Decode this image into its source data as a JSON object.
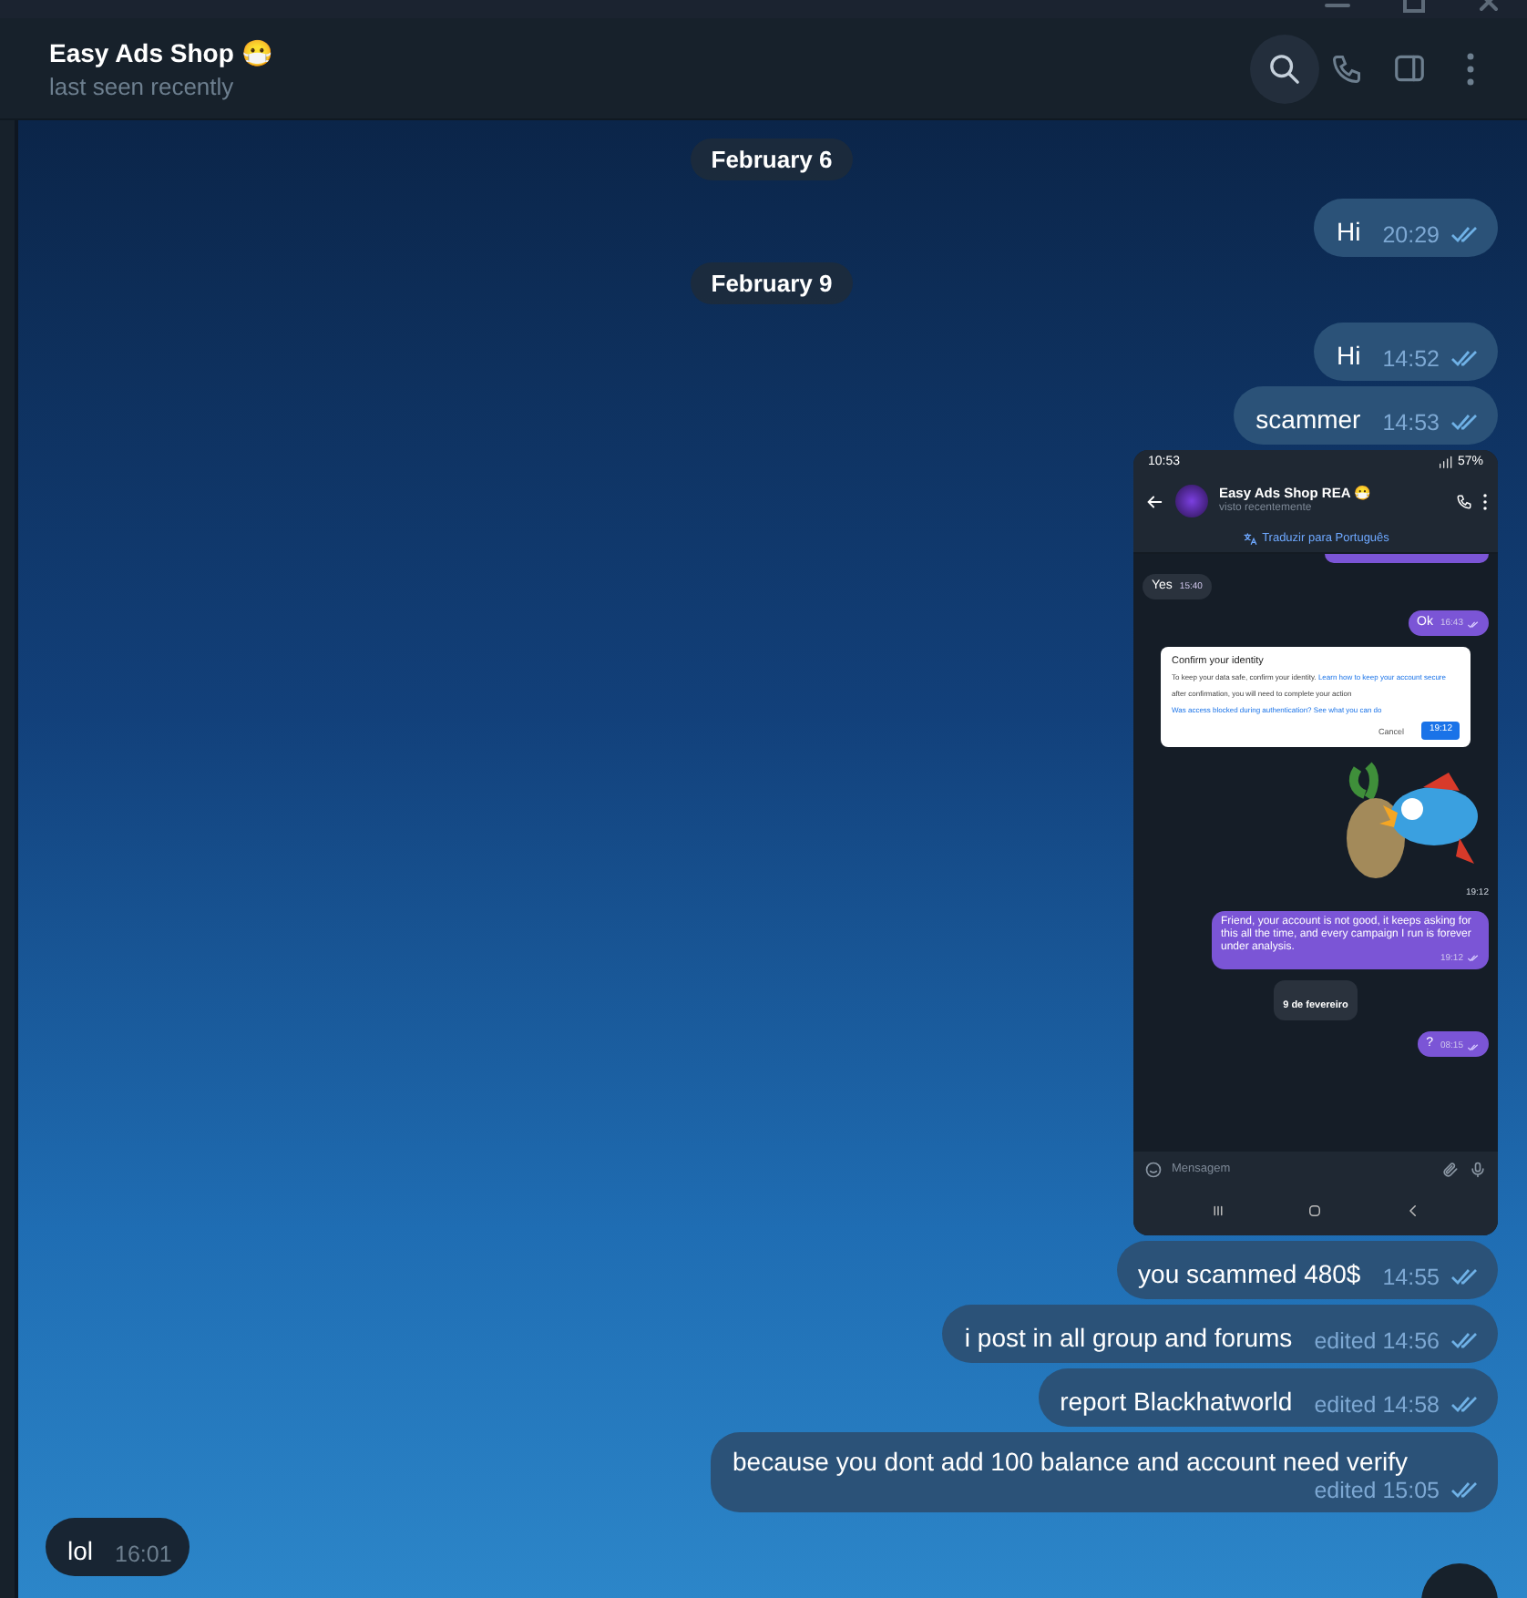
{
  "header": {
    "title": "Easy Ads Shop 😷",
    "status": "last seen recently"
  },
  "messages": [
    {
      "kind": "date",
      "text": "February 6"
    },
    {
      "kind": "text",
      "outgoing": true,
      "text": "Hi",
      "meta": "20:29",
      "read": true
    },
    {
      "kind": "date",
      "text": "February 9"
    },
    {
      "kind": "text",
      "outgoing": true,
      "text": "Hi",
      "meta": "14:52",
      "read": true
    },
    {
      "kind": "text",
      "outgoing": true,
      "text": "scammer",
      "meta": "14:53",
      "read": true
    },
    {
      "kind": "screenshot",
      "phone": {
        "clock": "10:53",
        "battery": "57%",
        "title": "Easy Ads Shop REA",
        "title_emoji": "😷",
        "subtitle": "visto recentemente",
        "translate": "Traduzir para Português",
        "placeholder": "Mensagem",
        "messages": [
          {
            "kind": "text",
            "outgoing": false,
            "text": "Yes",
            "time": "15:40"
          },
          {
            "kind": "text",
            "outgoing": true,
            "text": "Ok",
            "time": "16:43"
          },
          {
            "kind": "dialog",
            "title": "Confirm your identity",
            "body": "To keep your data safe, confirm your identity.",
            "link": "Learn how to keep your account secure",
            "note": "after confirmation, you will need to complete your action",
            "help": "Was access blocked during authentication? See what you can do",
            "cancel": "Cancel",
            "time": "19:12"
          },
          {
            "kind": "sticker",
            "time": "19:12"
          },
          {
            "kind": "text",
            "outgoing": true,
            "text": "Friend, your account is not good, it keeps asking for this all the time, and every campaign I run is forever under analysis.",
            "time": "19:12"
          },
          {
            "kind": "date",
            "text": "9 de fevereiro"
          },
          {
            "kind": "text",
            "outgoing": true,
            "text": "?",
            "time": "08:15"
          }
        ]
      }
    },
    {
      "kind": "text",
      "outgoing": true,
      "text": "you scammed 480$",
      "meta": "14:55",
      "read": true
    },
    {
      "kind": "text",
      "outgoing": true,
      "text": "i post in all group and forums",
      "meta": "edited 14:56",
      "read": true
    },
    {
      "kind": "text",
      "outgoing": true,
      "text": "report Blackhatworld",
      "meta": "edited 14:58",
      "read": true
    },
    {
      "kind": "text",
      "outgoing": true,
      "text": "because you dont add 100 balance and account need verify",
      "meta": "edited 15:05",
      "read": true
    },
    {
      "kind": "text",
      "outgoing": false,
      "text": "lol",
      "meta": "16:01"
    }
  ]
}
